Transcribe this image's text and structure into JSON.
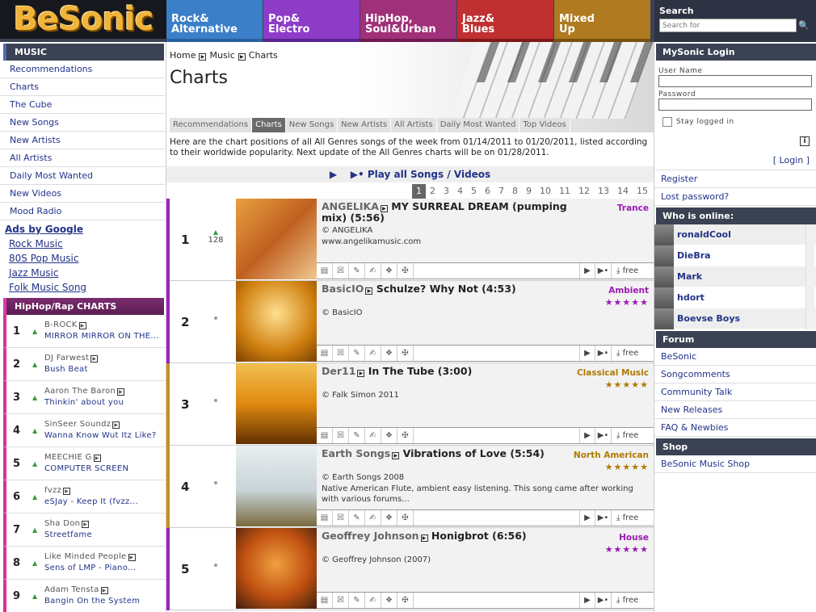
{
  "header": {
    "logo": "BeSonic",
    "genres": [
      {
        "l1": "Rock&",
        "l2": "Alternative",
        "bg": "#3a7fc8",
        "accent": "#2a5fa0"
      },
      {
        "l1": "Pop&",
        "l2": "Electro",
        "bg": "#8e3cc8",
        "accent": "#5a2490"
      },
      {
        "l1": "HipHop,",
        "l2": "Soul&Urban",
        "bg": "#a0307a",
        "accent": "#701a50"
      },
      {
        "l1": "Jazz&",
        "l2": "Blues",
        "bg": "#c03030",
        "accent": "#801818"
      },
      {
        "l1": "Mixed",
        "l2": "Up",
        "bg": "#b07a20",
        "accent": "#7a5010"
      }
    ],
    "search_title": "Search",
    "search_placeholder": "Search for"
  },
  "left": {
    "music_title": "MUSIC",
    "music_items": [
      "Recommendations",
      "Charts",
      "The Cube",
      "New Songs",
      "New Artists",
      "All Artists",
      "Daily Most Wanted",
      "New Videos",
      "Mood Radio"
    ],
    "ads_title": "Ads by Google",
    "ads": [
      "Rock Music",
      "80S Pop Music",
      "Jazz Music",
      "Folk Music Song"
    ],
    "hiphop_title": "HipHop/Rap CHARTS",
    "hiphop": [
      {
        "n": "1",
        "artist": "B-ROCK",
        "song": "MIRROR MIRROR ON THE..."
      },
      {
        "n": "2",
        "artist": "DJ Farwest",
        "song": "Bush Beat"
      },
      {
        "n": "3",
        "artist": "Aaron The Baron",
        "song": "Thinkin' about you"
      },
      {
        "n": "4",
        "artist": "SinSeer Soundz",
        "song": "Wanna Know Wut Itz Like?"
      },
      {
        "n": "5",
        "artist": "MEECHIE G",
        "song": "COMPUTER SCREEN"
      },
      {
        "n": "6",
        "artist": "fvzz",
        "song": "eSJay - Keep It (fvzz..."
      },
      {
        "n": "7",
        "artist": "Sha Don",
        "song": "Streetfame"
      },
      {
        "n": "8",
        "artist": "Like Minded People",
        "song": "Sens of LMP - Piano..."
      },
      {
        "n": "9",
        "artist": "Adam Tensta",
        "song": "Bangin On the System"
      }
    ]
  },
  "main": {
    "breadcrumb": [
      "Home",
      "Music",
      "Charts"
    ],
    "title": "Charts",
    "subtabs": [
      "Recommendations",
      "Charts",
      "New Songs",
      "New Artists",
      "All Artists",
      "Daily Most Wanted",
      "Top Videos"
    ],
    "intro": "Here are the chart positions of all All Genres songs of the week from 01/14/2011 to 01/20/2011, listed according to their worldwide popularity. Next update of the All Genres charts will be on 01/28/2011.",
    "play_all": "Play all Songs / Videos",
    "pages": [
      "1",
      "2",
      "3",
      "4",
      "5",
      "6",
      "7",
      "8",
      "9",
      "10",
      "11",
      "12",
      "13",
      "14",
      "15"
    ],
    "free_label": "free",
    "songs": [
      {
        "rank": "1",
        "move": "128",
        "artist": "ANGELIKA",
        "title": "MY SURREAL DREAM (pumping mix) (5:56)",
        "genre": "Trance",
        "genre_color": "#9a1ab0",
        "stars": "",
        "copyright": "© ANGELIKA",
        "desc": "www.angelikamusic.com",
        "bar": "#a020c0",
        "cover": "linear-gradient(135deg,#e8a040,#c06020 50%,#f0c890)"
      },
      {
        "rank": "2",
        "move": "",
        "artist": "BasicIO",
        "title": "Schulze? Why Not (4:53)",
        "genre": "Ambient",
        "genre_color": "#9a1ab0",
        "stars": "★★★★★",
        "copyright": "© BasicIO",
        "desc": "",
        "bar": "#a020c0",
        "cover": "radial-gradient(circle at 50% 40%,#ffe090,#d08010 60%,#7a4000)"
      },
      {
        "rank": "3",
        "move": "",
        "artist": "Der11",
        "title": "In The Tube (3:00)",
        "genre": "Classical Music",
        "genre_color": "#b07a00",
        "stars": "★★★★★",
        "copyright": "© Falk Simon 2011",
        "desc": "",
        "bar": "#c89020",
        "cover": "linear-gradient(180deg,#f0c050,#e08a10 50%,#603000)"
      },
      {
        "rank": "4",
        "move": "",
        "artist": "Earth Songs",
        "title": "Vibrations of Love (5:54)",
        "genre": "North American",
        "genre_color": "#b07a00",
        "stars": "★★★★★",
        "copyright": "© Earth Songs 2008",
        "desc": "Native American Flute, ambient easy listening. This song came after working with various forums...",
        "bar": "#c89020",
        "cover": "linear-gradient(180deg,#e8eef0,#c8d4d8 55%,#7a6a40)"
      },
      {
        "rank": "5",
        "move": "",
        "artist": "Geoffrey Johnson",
        "title": "Honigbrot (6:56)",
        "genre": "House",
        "genre_color": "#9a1ab0",
        "stars": "★★★★★",
        "copyright": "© Geoffrey Johnson (2007)",
        "desc": "",
        "bar": "#a020c0",
        "cover": "radial-gradient(circle at 50% 45%,#f0a040,#c05010 55%,#402010)"
      }
    ]
  },
  "right": {
    "login_title": "MySonic Login",
    "user_label": "User Name",
    "pass_label": "Password",
    "stay_label": "Stay logged in",
    "login_link": "[ Login ]",
    "register": "Register",
    "lost": "Lost password?",
    "online_title": "Who is online:",
    "online": [
      "ronaldCool",
      "DieBra",
      "Mark",
      "hdort",
      "Boevse Boys"
    ],
    "forum_title": "Forum",
    "forum": [
      "BeSonic",
      "Songcomments",
      "Community Talk",
      "New Releases",
      "FAQ & Newbies"
    ],
    "shop_title": "Shop",
    "shop": [
      "BeSonic Music Shop"
    ]
  }
}
